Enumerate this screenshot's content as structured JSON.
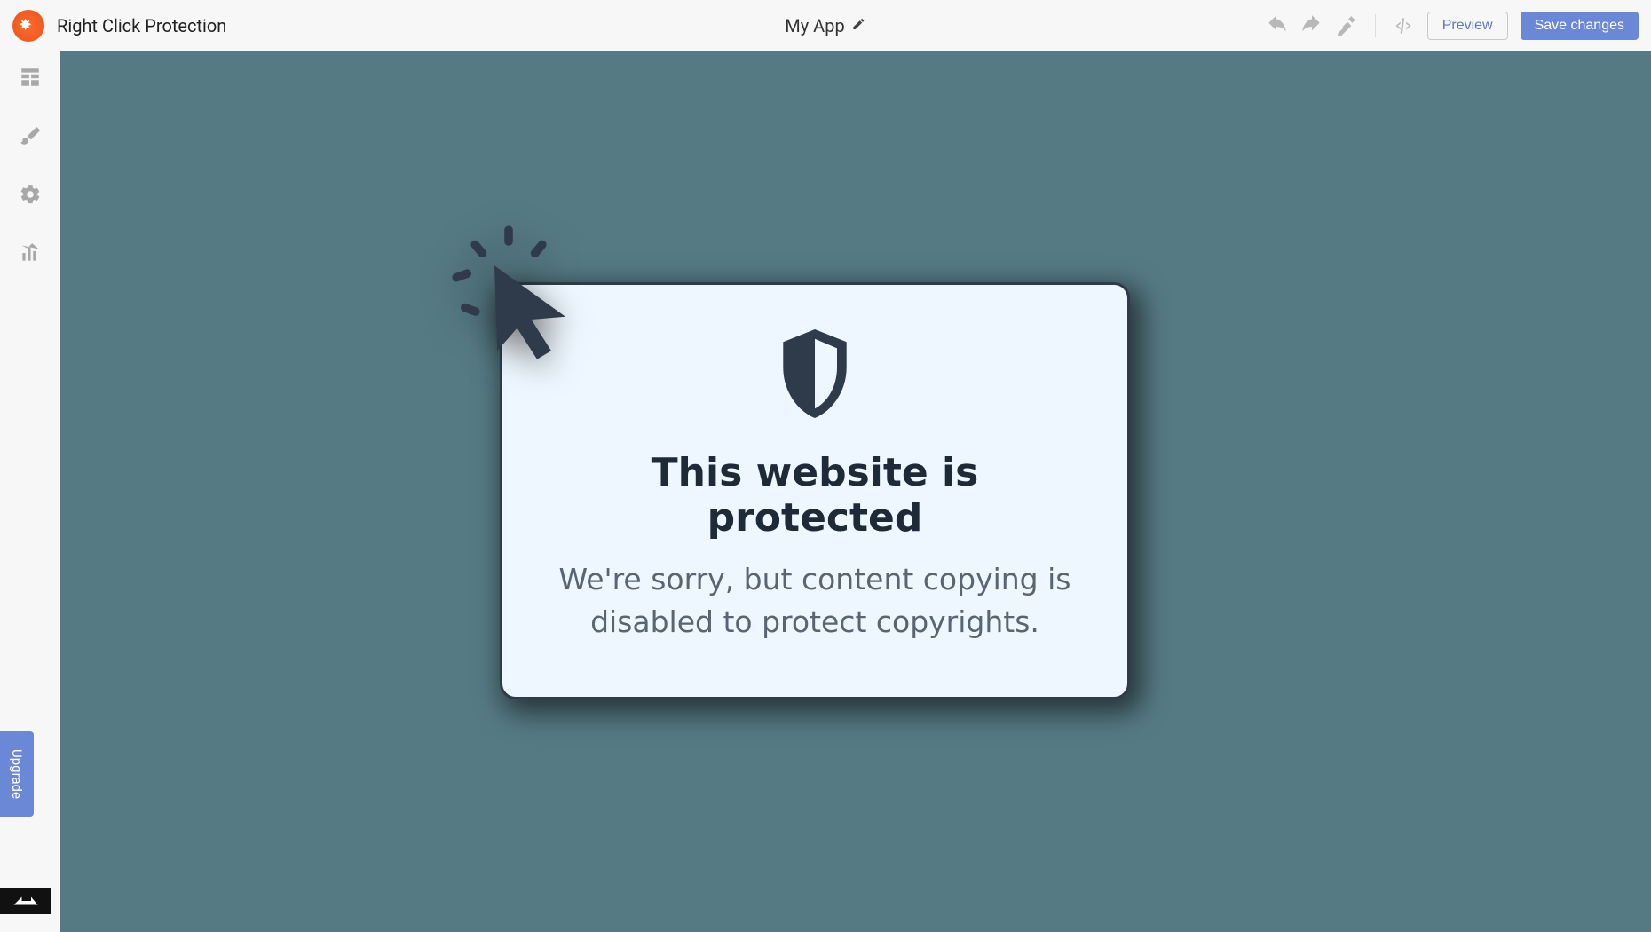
{
  "topbar": {
    "page_title": "Right Click Protection",
    "app_name": "My App",
    "preview_label": "Preview",
    "save_label": "Save changes"
  },
  "upgrade_label": "Upgrade",
  "card": {
    "heading": "This website is protected",
    "body": "We're sorry, but content copying is disabled to protect copyrights."
  }
}
